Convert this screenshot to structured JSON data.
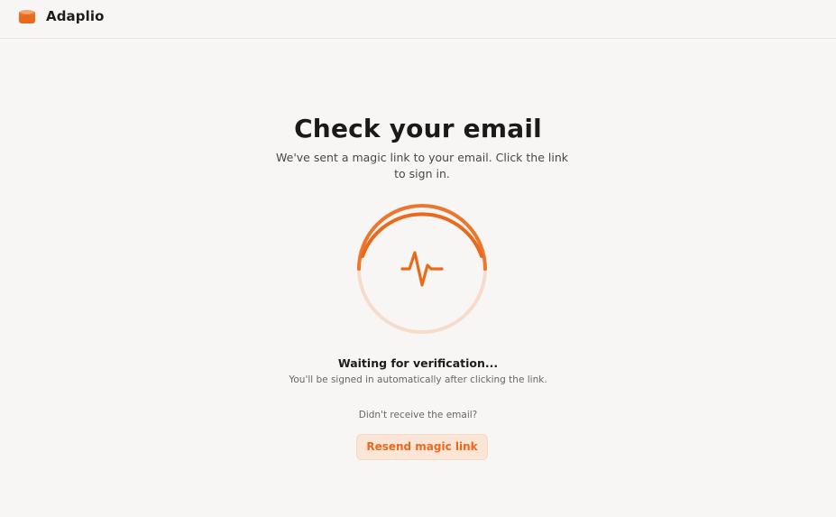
{
  "app": {
    "name": "Adaplio",
    "logo_icon": "cylinder-icon"
  },
  "colors": {
    "accent": "#ea6a1d",
    "accent_light": "#f6d8c3",
    "background": "#f8f6f4"
  },
  "main": {
    "title": "Check your email",
    "subtitle": "We've sent a magic link to your email. Click the link to sign in.",
    "status_icon": "activity-pulse-icon",
    "waiting_text": "Waiting for verification...",
    "auto_signin_text": "You'll be signed in automatically after clicking the link.",
    "didnt_receive_text": "Didn't receive the email?",
    "resend_label": "Resend magic link"
  }
}
